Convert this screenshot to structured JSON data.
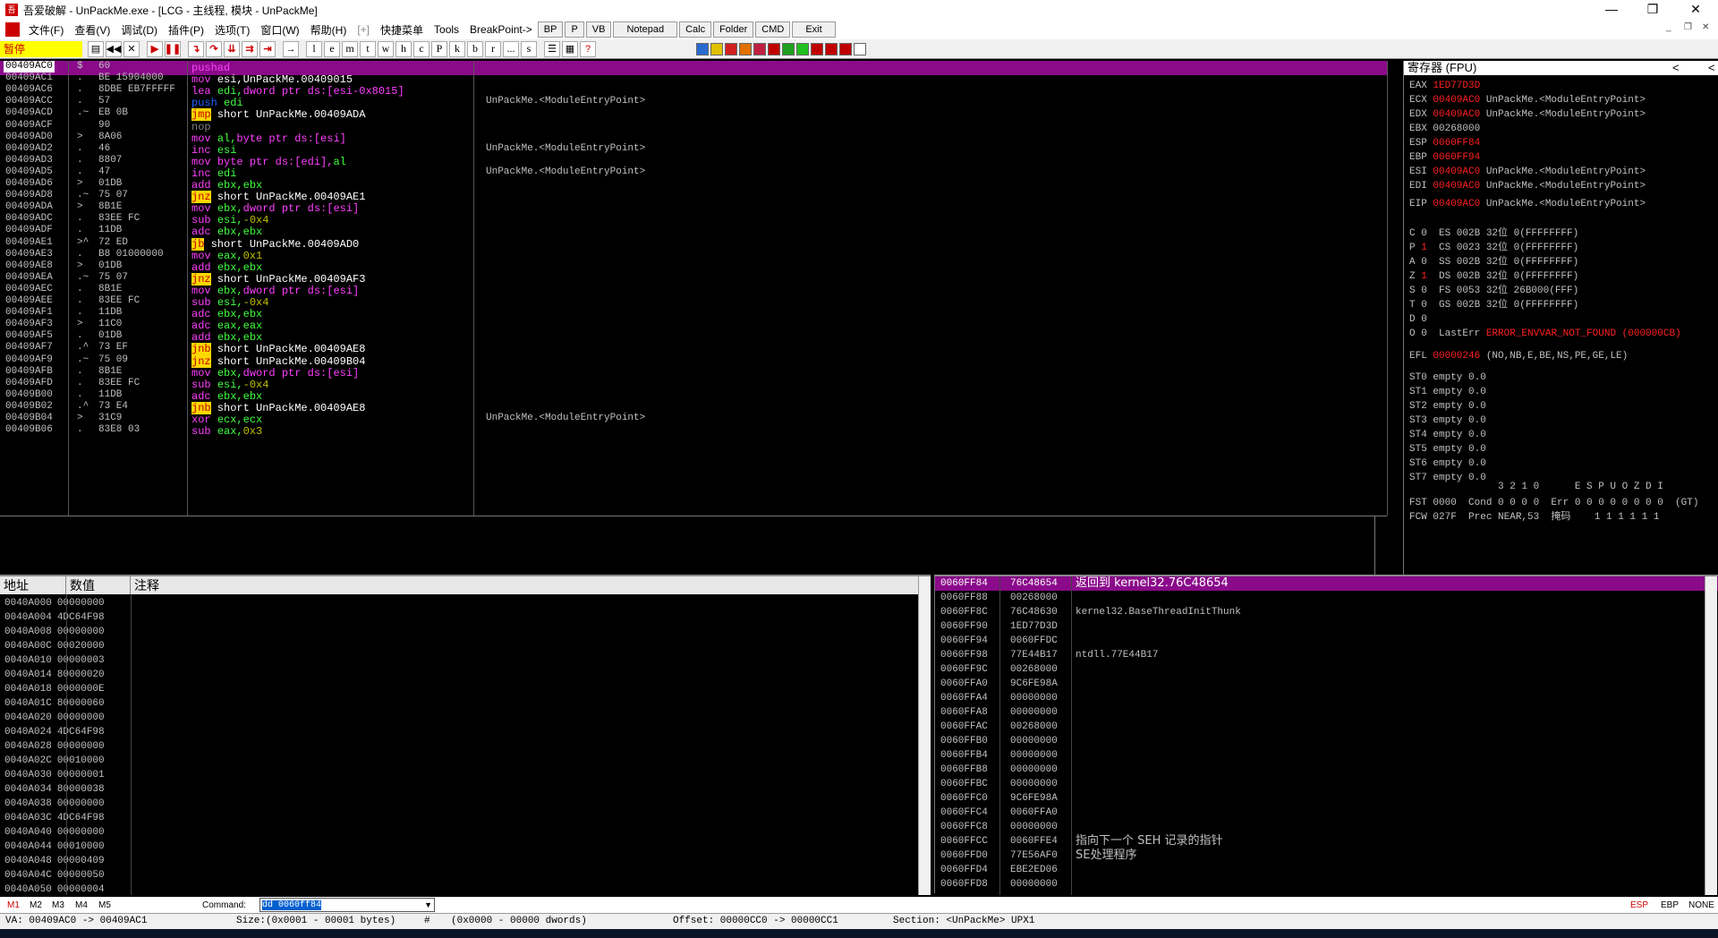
{
  "window": {
    "title": "吾爱破解 - UnPackMe.exe - [LCG - 主线程, 模块 - UnPackMe]",
    "app_icon": "吾",
    "controls": [
      "—",
      "❐",
      "✕"
    ]
  },
  "menu": {
    "items": [
      "文件(F)",
      "查看(V)",
      "调试(D)",
      "插件(P)",
      "选项(T)",
      "窗口(W)",
      "帮助(H)",
      "[+]",
      "快捷菜单",
      "Tools",
      "BreakPoint->"
    ],
    "buttons": [
      "BP",
      "P",
      "VB",
      "Notepad",
      "Calc",
      "Folder",
      "CMD",
      "Exit"
    ],
    "mdi_controls": [
      "_",
      "❐",
      "✕"
    ]
  },
  "toolbar": {
    "status": "暂停",
    "letters": [
      "l",
      "e",
      "m",
      "t",
      "w",
      "h",
      "c",
      "P",
      "k",
      "b",
      "r",
      "...",
      "s"
    ]
  },
  "cpu": {
    "rows": [
      {
        "addr": "00409AC0",
        "mark": "$",
        "hex": "60",
        "asm": [
          [
            "pushad",
            "cmd"
          ]
        ],
        "cmt": ""
      },
      {
        "addr": "00409AC1",
        "mark": ".",
        "hex": "BE 15904000",
        "asm": [
          [
            "mov ",
            "mov"
          ],
          [
            "esi,UnPackMe.00409015",
            "txt"
          ]
        ],
        "cmt": ""
      },
      {
        "addr": "00409AC6",
        "mark": ".",
        "hex": "8DBE EB7FFFFF",
        "asm": [
          [
            "lea ",
            "mov"
          ],
          [
            "edi,",
            "reg"
          ],
          [
            "dword ptr ds:[esi-0x8015]",
            "mem"
          ]
        ],
        "cmt": ""
      },
      {
        "addr": "00409ACC",
        "mark": ".",
        "hex": "57",
        "asm": [
          [
            "push ",
            "push"
          ],
          [
            "edi",
            "reg"
          ]
        ],
        "cmt": "UnPackMe.<ModuleEntryPoint>"
      },
      {
        "addr": "00409ACD",
        "mark": ".~",
        "hex": "EB 0B",
        "asm": [
          [
            "jmp",
            "jmp"
          ],
          [
            " short UnPackMe.00409ADA",
            "txt"
          ]
        ],
        "cmt": ""
      },
      {
        "addr": "00409ACF",
        "mark": "",
        "hex": "90",
        "asm": [
          [
            "nop",
            "nop"
          ]
        ],
        "cmt": ""
      },
      {
        "addr": "00409AD0",
        "mark": ">",
        "hex": "8A06",
        "asm": [
          [
            "mov ",
            "mov"
          ],
          [
            "al,",
            "reg"
          ],
          [
            "byte ptr ds:[esi]",
            "mem"
          ]
        ],
        "cmt": ""
      },
      {
        "addr": "00409AD2",
        "mark": ".",
        "hex": "46",
        "asm": [
          [
            "inc ",
            "mov"
          ],
          [
            "esi",
            "reg"
          ]
        ],
        "cmt": "UnPackMe.<ModuleEntryPoint>"
      },
      {
        "addr": "00409AD3",
        "mark": ".",
        "hex": "8807",
        "asm": [
          [
            "mov ",
            "mov"
          ],
          [
            "byte ptr ds:[edi],",
            "mem"
          ],
          [
            "al",
            "reg"
          ]
        ],
        "cmt": ""
      },
      {
        "addr": "00409AD5",
        "mark": ".",
        "hex": "47",
        "asm": [
          [
            "inc ",
            "mov"
          ],
          [
            "edi",
            "reg"
          ]
        ],
        "cmt": "UnPackMe.<ModuleEntryPoint>"
      },
      {
        "addr": "00409AD6",
        "mark": ">",
        "hex": "01DB",
        "asm": [
          [
            "add ",
            "mov"
          ],
          [
            "ebx,ebx",
            "reg"
          ]
        ],
        "cmt": ""
      },
      {
        "addr": "00409AD8",
        "mark": ".~",
        "hex": "75 07",
        "asm": [
          [
            "jnz",
            "jmp"
          ],
          [
            " short UnPackMe.00409AE1",
            "txt"
          ]
        ],
        "cmt": ""
      },
      {
        "addr": "00409ADA",
        "mark": ">",
        "hex": "8B1E",
        "asm": [
          [
            "mov ",
            "mov"
          ],
          [
            "ebx,",
            "reg"
          ],
          [
            "dword ptr ds:[esi]",
            "mem"
          ]
        ],
        "cmt": ""
      },
      {
        "addr": "00409ADC",
        "mark": ".",
        "hex": "83EE FC",
        "asm": [
          [
            "sub ",
            "mov"
          ],
          [
            "esi,",
            "reg"
          ],
          [
            "-0x4",
            "num"
          ]
        ],
        "cmt": ""
      },
      {
        "addr": "00409ADF",
        "mark": ".",
        "hex": "11DB",
        "asm": [
          [
            "adc ",
            "mov"
          ],
          [
            "ebx,ebx",
            "reg"
          ]
        ],
        "cmt": ""
      },
      {
        "addr": "00409AE1",
        "mark": ">^",
        "hex": "72 ED",
        "asm": [
          [
            "jb",
            "jmp"
          ],
          [
            " short UnPackMe.00409AD0",
            "txt"
          ]
        ],
        "cmt": ""
      },
      {
        "addr": "00409AE3",
        "mark": ".",
        "hex": "B8 01000000",
        "asm": [
          [
            "mov ",
            "mov"
          ],
          [
            "eax,",
            "reg"
          ],
          [
            "0x1",
            "num"
          ]
        ],
        "cmt": ""
      },
      {
        "addr": "00409AE8",
        "mark": ">",
        "hex": "01DB",
        "asm": [
          [
            "add ",
            "mov"
          ],
          [
            "ebx,ebx",
            "reg"
          ]
        ],
        "cmt": ""
      },
      {
        "addr": "00409AEA",
        "mark": ".~",
        "hex": "75 07",
        "asm": [
          [
            "jnz",
            "jmp"
          ],
          [
            " short UnPackMe.00409AF3",
            "txt"
          ]
        ],
        "cmt": ""
      },
      {
        "addr": "00409AEC",
        "mark": ".",
        "hex": "8B1E",
        "asm": [
          [
            "mov ",
            "mov"
          ],
          [
            "ebx,",
            "reg"
          ],
          [
            "dword ptr ds:[esi]",
            "mem"
          ]
        ],
        "cmt": ""
      },
      {
        "addr": "00409AEE",
        "mark": ".",
        "hex": "83EE FC",
        "asm": [
          [
            "sub ",
            "mov"
          ],
          [
            "esi,",
            "reg"
          ],
          [
            "-0x4",
            "num"
          ]
        ],
        "cmt": ""
      },
      {
        "addr": "00409AF1",
        "mark": ".",
        "hex": "11DB",
        "asm": [
          [
            "adc ",
            "mov"
          ],
          [
            "ebx,ebx",
            "reg"
          ]
        ],
        "cmt": ""
      },
      {
        "addr": "00409AF3",
        "mark": ">",
        "hex": "11C0",
        "asm": [
          [
            "adc ",
            "mov"
          ],
          [
            "eax,eax",
            "reg"
          ]
        ],
        "cmt": ""
      },
      {
        "addr": "00409AF5",
        "mark": ".",
        "hex": "01DB",
        "asm": [
          [
            "add ",
            "mov"
          ],
          [
            "ebx,ebx",
            "reg"
          ]
        ],
        "cmt": ""
      },
      {
        "addr": "00409AF7",
        "mark": ".^",
        "hex": "73 EF",
        "asm": [
          [
            "jnb",
            "jmp"
          ],
          [
            " short UnPackMe.00409AE8",
            "txt"
          ]
        ],
        "cmt": ""
      },
      {
        "addr": "00409AF9",
        "mark": ".~",
        "hex": "75 09",
        "asm": [
          [
            "jnz",
            "jmp"
          ],
          [
            " short UnPackMe.00409B04",
            "txt"
          ]
        ],
        "cmt": ""
      },
      {
        "addr": "00409AFB",
        "mark": ".",
        "hex": "8B1E",
        "asm": [
          [
            "mov ",
            "mov"
          ],
          [
            "ebx,",
            "reg"
          ],
          [
            "dword ptr ds:[esi]",
            "mem"
          ]
        ],
        "cmt": ""
      },
      {
        "addr": "00409AFD",
        "mark": ".",
        "hex": "83EE FC",
        "asm": [
          [
            "sub ",
            "mov"
          ],
          [
            "esi,",
            "reg"
          ],
          [
            "-0x4",
            "num"
          ]
        ],
        "cmt": ""
      },
      {
        "addr": "00409B00",
        "mark": ".",
        "hex": "11DB",
        "asm": [
          [
            "adc ",
            "mov"
          ],
          [
            "ebx,ebx",
            "reg"
          ]
        ],
        "cmt": ""
      },
      {
        "addr": "00409B02",
        "mark": ".^",
        "hex": "73 E4",
        "asm": [
          [
            "jnb",
            "jmp"
          ],
          [
            " short UnPackMe.00409AE8",
            "txt"
          ]
        ],
        "cmt": ""
      },
      {
        "addr": "00409B04",
        "mark": ">",
        "hex": "31C9",
        "asm": [
          [
            "xor ",
            "mov"
          ],
          [
            "ecx,ecx",
            "reg"
          ]
        ],
        "cmt": "UnPackMe.<ModuleEntryPoint>"
      },
      {
        "addr": "00409B06",
        "mark": ".",
        "hex": "83E8 03",
        "asm": [
          [
            "sub ",
            "mov"
          ],
          [
            "eax,",
            "reg"
          ],
          [
            "0x3",
            "num"
          ]
        ],
        "cmt": ""
      }
    ]
  },
  "registers": {
    "title": "寄存器 (FPU)",
    "nav": [
      "<",
      "<"
    ],
    "lines": [
      [
        [
          "EAX ",
          ""
        ],
        [
          "1ED77D3D",
          "red"
        ]
      ],
      [
        [
          "ECX ",
          ""
        ],
        [
          "00409AC0",
          "red"
        ],
        [
          " UnPackMe.<ModuleEntryPoint>",
          ""
        ]
      ],
      [
        [
          "EDX ",
          ""
        ],
        [
          "00409AC0",
          "red"
        ],
        [
          " UnPackMe.<ModuleEntryPoint>",
          ""
        ]
      ],
      [
        [
          "EBX 00268000",
          ""
        ]
      ],
      [
        [
          "ESP ",
          ""
        ],
        [
          "0060FF84",
          "red"
        ]
      ],
      [
        [
          "EBP ",
          ""
        ],
        [
          "0060FF94",
          "red"
        ]
      ],
      [
        [
          "ESI ",
          ""
        ],
        [
          "00409AC0",
          "red"
        ],
        [
          " UnPackMe.<ModuleEntryPoint>",
          ""
        ]
      ],
      [
        [
          "EDI ",
          ""
        ],
        [
          "00409AC0",
          "red"
        ],
        [
          " UnPackMe.<ModuleEntryPoint>",
          ""
        ]
      ],
      [
        [
          "",
          ""
        ]
      ],
      [
        [
          "EIP ",
          ""
        ],
        [
          "00409AC0",
          "red"
        ],
        [
          " UnPackMe.<ModuleEntryPoint>",
          ""
        ]
      ],
      [
        [
          "",
          ""
        ]
      ],
      [
        [
          "C 0  ES 002B 32位 0(FFFFFFFF)",
          ""
        ]
      ],
      [
        [
          "P ",
          ""
        ],
        [
          "1",
          "red"
        ],
        [
          "  CS 0023 32位 0(FFFFFFFF)",
          ""
        ]
      ],
      [
        [
          "A 0  SS 002B 32位 0(FFFFFFFF)",
          ""
        ]
      ],
      [
        [
          "Z ",
          ""
        ],
        [
          "1",
          "red"
        ],
        [
          "  DS 002B 32位 0(FFFFFFFF)",
          ""
        ]
      ],
      [
        [
          "S 0  FS 0053 32位 26B000(FFF)",
          ""
        ]
      ],
      [
        [
          "T 0  GS 002B 32位 0(FFFFFFFF)",
          ""
        ]
      ],
      [
        [
          "D 0",
          ""
        ]
      ],
      [
        [
          "O 0  LastErr ",
          ""
        ],
        [
          "ERROR_ENVVAR_NOT_FOUND (000000CB)",
          "red"
        ]
      ],
      [
        [
          "",
          ""
        ]
      ],
      [
        [
          "EFL ",
          ""
        ],
        [
          "00000246",
          "red"
        ],
        [
          " (NO,NB,E,BE,NS,PE,GE,LE)",
          ""
        ]
      ],
      [
        [
          "",
          ""
        ]
      ],
      [
        [
          "ST0 empty 0.0",
          ""
        ]
      ],
      [
        [
          "ST1 empty 0.0",
          ""
        ]
      ],
      [
        [
          "ST2 empty 0.0",
          ""
        ]
      ],
      [
        [
          "ST3 empty 0.0",
          ""
        ]
      ],
      [
        [
          "ST4 empty 0.0",
          ""
        ]
      ],
      [
        [
          "ST5 empty 0.0",
          ""
        ]
      ],
      [
        [
          "ST6 empty 0.0",
          ""
        ]
      ],
      [
        [
          "ST7 empty 0.0",
          ""
        ]
      ],
      [
        [
          "               3 2 1 0      E S P U O Z D I",
          ""
        ]
      ],
      [
        [
          "FST 0000  Cond 0 0 0 0  Err 0 0 0 0 0 0 0 0  (GT)",
          ""
        ]
      ],
      [
        [
          "FCW 027F  Prec NEAR,53  掩码    1 1 1 1 1 1",
          ""
        ]
      ]
    ]
  },
  "dump": {
    "headers": [
      "地址",
      "数值",
      "注释"
    ],
    "rows": [
      [
        "0040A000",
        "00000000"
      ],
      [
        "0040A004",
        "4DC64F98"
      ],
      [
        "0040A008",
        "00000000"
      ],
      [
        "0040A00C",
        "00020000"
      ],
      [
        "0040A010",
        "00000003"
      ],
      [
        "0040A014",
        "80000020"
      ],
      [
        "0040A018",
        "0000000E"
      ],
      [
        "0040A01C",
        "80000060"
      ],
      [
        "0040A020",
        "00000000"
      ],
      [
        "0040A024",
        "4DC64F98"
      ],
      [
        "0040A028",
        "00000000"
      ],
      [
        "0040A02C",
        "00010000"
      ],
      [
        "0040A030",
        "00000001"
      ],
      [
        "0040A034",
        "80000038"
      ],
      [
        "0040A038",
        "00000000"
      ],
      [
        "0040A03C",
        "4DC64F98"
      ],
      [
        "0040A040",
        "00000000"
      ],
      [
        "0040A044",
        "00010000"
      ],
      [
        "0040A048",
        "00000409"
      ],
      [
        "0040A04C",
        "00000050"
      ],
      [
        "0040A050",
        "00000004"
      ]
    ]
  },
  "stack": {
    "rows": [
      [
        "0060FF84",
        "76C48654",
        "返回到 kernel32.76C48654"
      ],
      [
        "0060FF88",
        "00268000",
        ""
      ],
      [
        "0060FF8C",
        "76C48630",
        "kernel32.BaseThreadInitThunk"
      ],
      [
        "0060FF90",
        "1ED77D3D",
        ""
      ],
      [
        "0060FF94",
        "0060FFDC",
        ""
      ],
      [
        "0060FF98",
        "77E44B17",
        "ntdll.77E44B17"
      ],
      [
        "0060FF9C",
        "00268000",
        ""
      ],
      [
        "0060FFA0",
        "9C6FE98A",
        ""
      ],
      [
        "0060FFA4",
        "00000000",
        ""
      ],
      [
        "0060FFA8",
        "00000000",
        ""
      ],
      [
        "0060FFAC",
        "00268000",
        ""
      ],
      [
        "0060FFB0",
        "00000000",
        ""
      ],
      [
        "0060FFB4",
        "00000000",
        ""
      ],
      [
        "0060FFB8",
        "00000000",
        ""
      ],
      [
        "0060FFBC",
        "00000000",
        ""
      ],
      [
        "0060FFC0",
        "9C6FE98A",
        ""
      ],
      [
        "0060FFC4",
        "0060FFA0",
        ""
      ],
      [
        "0060FFC8",
        "00000000",
        ""
      ],
      [
        "0060FFCC",
        "0060FFE4",
        "指向下一个 SEH 记录的指针"
      ],
      [
        "0060FFD0",
        "77E56AF0",
        "SE处理程序"
      ],
      [
        "0060FFD4",
        "EBE2ED06",
        ""
      ],
      [
        "0060FFD8",
        "00000000",
        ""
      ]
    ]
  },
  "command": {
    "tabs": [
      "M1",
      "M2",
      "M3",
      "M4",
      "M5"
    ],
    "label": "Command:",
    "value": "dd 0060ff84",
    "right": [
      "ESP",
      "EBP",
      "NONE"
    ]
  },
  "status": {
    "va": "VA: 00409AC0 -> 00409AC1",
    "size": "Size:(0x0001 - 00001 bytes)",
    "hash": "#",
    "dwords": "(0x0000 - 00000 dwords)",
    "offset": "Offset: 00000CC0 -> 00000CC1",
    "section": "Section: <UnPackMe> UPX1"
  },
  "colors": {
    "highlight": "#8a0a8a",
    "cmd": "#ff40ff",
    "mov": "#ff40ff",
    "reg": "#40ff40",
    "mem": "#ff40ff",
    "num": "#c0c000",
    "jmp_bg": "#ffd800",
    "jmp_fg": "#c00000",
    "push": "#2060ff",
    "nop": "#808080",
    "txt": "#ffffff"
  }
}
